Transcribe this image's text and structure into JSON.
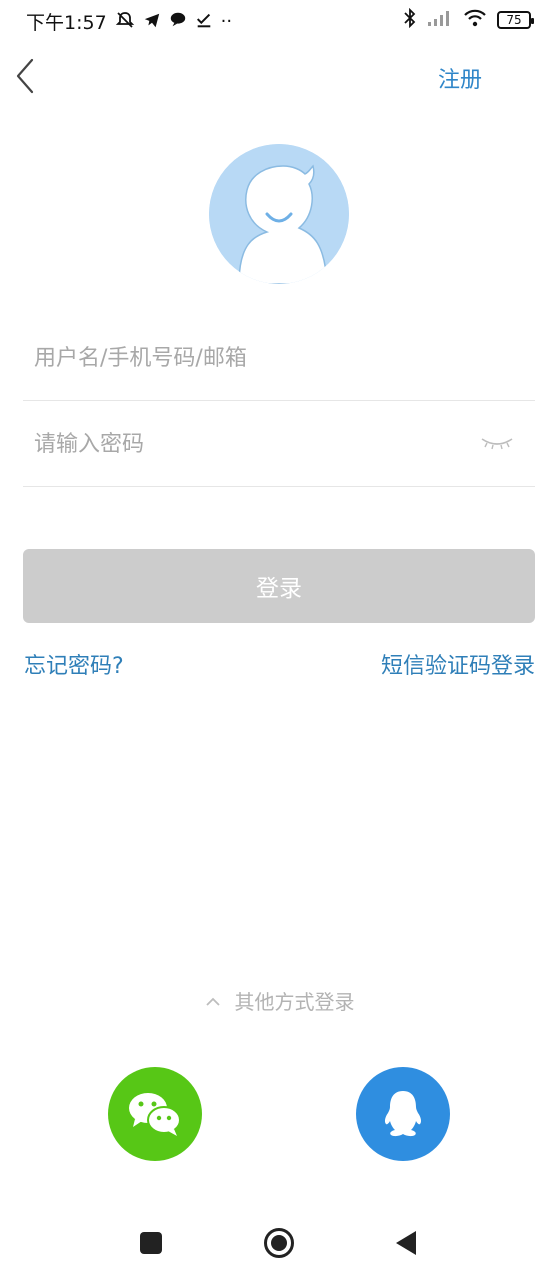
{
  "status_bar": {
    "time": "下午1:57",
    "battery": "75",
    "extra_dots": "··"
  },
  "header": {
    "register_label": "注册"
  },
  "form": {
    "username_placeholder": "用户名/手机号码/邮箱",
    "password_placeholder": "请输入密码",
    "login_label": "登录"
  },
  "links": {
    "forgot_password": "忘记密码?",
    "sms_login": "短信验证码登录"
  },
  "other_login": {
    "label": "其他方式登录"
  },
  "colors": {
    "accent": "#2f86c9",
    "login_button_disabled": "#cccccc",
    "wechat": "#57c716",
    "qq": "#2f8ee0",
    "avatar_bg": "#b8d9f5"
  },
  "icons": {
    "wechat": "wechat-icon",
    "qq": "qq-icon"
  }
}
